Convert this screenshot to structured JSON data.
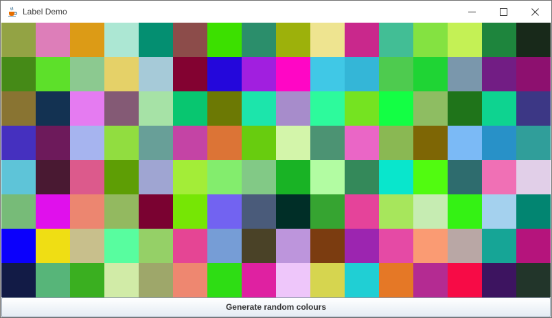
{
  "window": {
    "title": "Label Demo",
    "app_icon": "java-coffee-cup-icon",
    "controls": [
      "minimize-icon",
      "maximize-icon",
      "close-icon"
    ]
  },
  "grid": {
    "rows": 8,
    "cols": 16,
    "colors": [
      [
        "#93a344",
        "#dd7eb9",
        "#dc9b16",
        "#ace7d3",
        "#048f71",
        "#8c4c4a",
        "#3ce000",
        "#2b8e6b",
        "#9db10b",
        "#eee490",
        "#c9288c",
        "#42be95",
        "#84e241",
        "#c4f155",
        "#1e853d",
        "#18291a"
      ],
      [
        "#458a17",
        "#5de02a",
        "#8cc990",
        "#e5d168",
        "#a6cad8",
        "#830231",
        "#2407db",
        "#a11fdf",
        "#ff06c5",
        "#40c8e6",
        "#34b6d7",
        "#4ecb4f",
        "#1fd434",
        "#7a97ac",
        "#721d84",
        "#8d106f"
      ],
      [
        "#897432",
        "#133252",
        "#e57bf1",
        "#845a75",
        "#a6e2a6",
        "#08c670",
        "#6c7904",
        "#1ce5ab",
        "#a78ccb",
        "#2dfa9c",
        "#75e321",
        "#13ff44",
        "#8ebd62",
        "#1f741a",
        "#0ed390",
        "#3c3785"
      ],
      [
        "#4530bf",
        "#6d1a5b",
        "#a6b4ef",
        "#91dd40",
        "#689f98",
        "#c444a5",
        "#dc7436",
        "#68cc0f",
        "#d3f5aa",
        "#4c9373",
        "#ea66c6",
        "#8ab853",
        "#7e6605",
        "#7bbaf6",
        "#2891c8",
        "#309e9a"
      ],
      [
        "#5ec4d8",
        "#491932",
        "#dc5a8c",
        "#5e9e05",
        "#9fa5d2",
        "#a3ed38",
        "#83ed6d",
        "#82c986",
        "#19b325",
        "#b2fca2",
        "#34895a",
        "#09e6cc",
        "#51fb10",
        "#2e6c6e",
        "#f070b5",
        "#e1cfe8"
      ],
      [
        "#77bb78",
        "#e010ec",
        "#ec8670",
        "#93b960",
        "#7a0231",
        "#76e605",
        "#7263f1",
        "#4a5b7a",
        "#002e27",
        "#36a431",
        "#e5439a",
        "#a7e65c",
        "#c6ecb2",
        "#34f214",
        "#a4d1ee",
        "#028571"
      ],
      [
        "#0b00fc",
        "#efde14",
        "#c8bf8c",
        "#58fd9f",
        "#95d067",
        "#e54594",
        "#769dd6",
        "#4a4227",
        "#bd95dc",
        "#7b3c10",
        "#9c25b0",
        "#e54aa5",
        "#fa9b73",
        "#b9a7a5",
        "#16a596",
        "#b5147c"
      ],
      [
        "#121b46",
        "#57b579",
        "#3aaf20",
        "#d1eba7",
        "#9ea76a",
        "#ee8770",
        "#2edd14",
        "#df21a1",
        "#eec6fa",
        "#d6d54f",
        "#20cfd4",
        "#e57826",
        "#b42b92",
        "#f70b46",
        "#3d1460",
        "#22352a"
      ]
    ]
  },
  "button": {
    "label": "Generate random colours"
  }
}
